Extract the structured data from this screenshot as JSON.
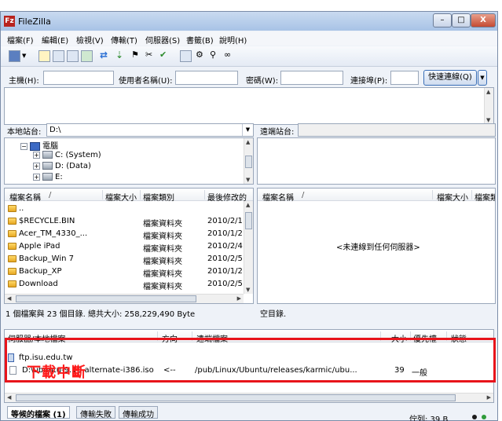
{
  "window": {
    "title": "FileZilla",
    "app_icon": "Fz",
    "controls": {
      "minimize": "–",
      "maximize": "□",
      "close": "X"
    }
  },
  "menu": [
    "檔案(F)",
    "編輯(E)",
    "檢視(V)",
    "傳輸(T)",
    "伺服器(S)",
    "書籤(B)",
    "說明(H)"
  ],
  "quickconnect": {
    "host_label": "主機(H):",
    "user_label": "使用者名稱(U):",
    "password_label": "密碼(W):",
    "port_label": "連接埠(P):",
    "button_label": "快速連線(Q)",
    "host_value": "",
    "user_value": "",
    "password_value": "",
    "port_value": ""
  },
  "local": {
    "site_label": "本地站台:",
    "path": "D:\\",
    "tree": [
      {
        "label": "電腦",
        "type": "pc"
      },
      {
        "label": "C: (System)",
        "type": "drive"
      },
      {
        "label": "D: (Data)",
        "type": "drive"
      },
      {
        "label": "E:",
        "type": "drive"
      }
    ],
    "columns": [
      "檔案名稱",
      "/",
      "檔案大小",
      "檔案類別",
      "最後修改的"
    ],
    "files": [
      {
        "name": "..",
        "size": "",
        "type": "",
        "modified": ""
      },
      {
        "name": "$RECYCLE.BIN",
        "size": "",
        "type": "檔案資料夾",
        "modified": "2010/2/1"
      },
      {
        "name": "Acer_TM_4330_...",
        "size": "",
        "type": "檔案資料夾",
        "modified": "2010/1/2"
      },
      {
        "name": "Apple iPad",
        "size": "",
        "type": "檔案資料夾",
        "modified": "2010/2/4"
      },
      {
        "name": "Backup_Win 7",
        "size": "",
        "type": "檔案資料夾",
        "modified": "2010/2/5"
      },
      {
        "name": "Backup_XP",
        "size": "",
        "type": "檔案資料夾",
        "modified": "2010/1/2"
      },
      {
        "name": "Download",
        "size": "",
        "type": "檔案資料夾",
        "modified": "2010/2/5"
      }
    ],
    "status": "1 個檔案與 23 個目錄. 總共大小: 258,229,490 Byte"
  },
  "remote": {
    "site_label": "遠端站台:",
    "path": "",
    "columns": [
      "檔案名稱",
      "/",
      "檔案大小",
      "檔案類"
    ],
    "empty_message": "<未連線到任何伺服器>",
    "status": "空目錄."
  },
  "queue": {
    "columns": [
      "伺服器/本地檔案",
      "方向",
      "遠端檔案",
      "大小",
      "優先權",
      "狀態"
    ],
    "server": "ftp.isu.edu.tw",
    "item": {
      "local_file": "D:\\ubuntu-9.10-alternate-i386.iso",
      "direction": "<--",
      "remote_file": "/pub/Linux/Ubuntu/releases/karmic/ubu...",
      "size": "39",
      "priority": "一般",
      "status": ""
    },
    "annotation": "下載中斷"
  },
  "tabs": [
    "等候的檔案 (1)",
    "傳輸失敗",
    "傳輸成功"
  ],
  "statusbar": {
    "queue": "佇列: 39 B"
  },
  "colors": {
    "annotation": "#e8141b",
    "dot_a": "#1b1b1b",
    "dot_b": "#2f9b3a"
  }
}
